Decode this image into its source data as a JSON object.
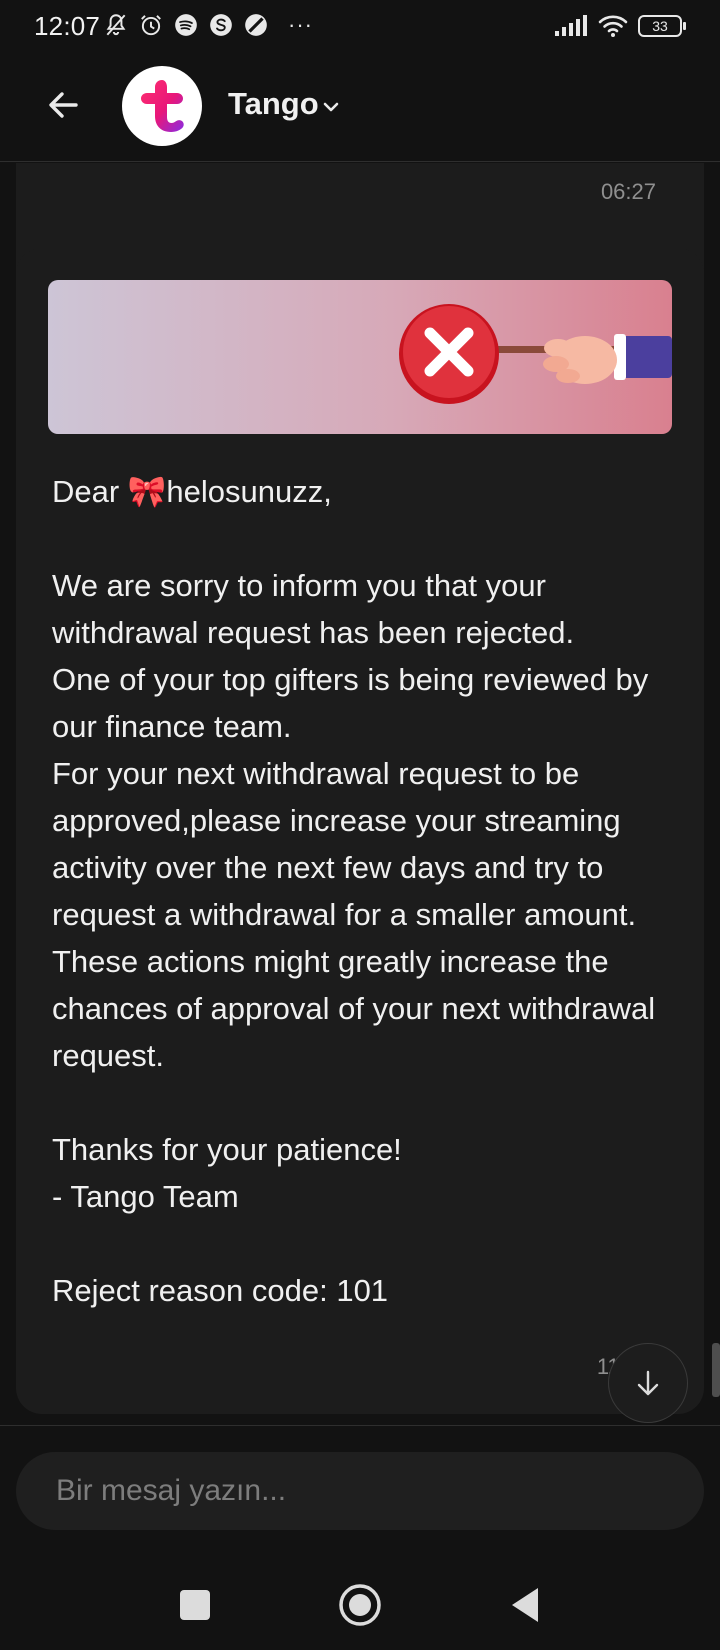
{
  "status_bar": {
    "time": "12:07",
    "battery": "33",
    "more": "···",
    "icons": [
      "bell-off-icon",
      "alarm-icon",
      "spotify-icon",
      "s-app-icon",
      "dnd-icon",
      "signal-icon",
      "wifi-icon",
      "battery-icon"
    ]
  },
  "header": {
    "title": "Tango",
    "avatar_letter": "t"
  },
  "chat": {
    "previous_message_time": "06:27",
    "message": {
      "text": "Dear 🎀helosunuzz,\n\nWe are sorry to inform you that your withdrawal request has been rejected.\nOne of your top gifters is being reviewed by our finance team.\nFor your next withdrawal request to be approved,please increase your streaming activity over the next few days and try to request a withdrawal for a smaller amount.\nThese actions might greatly increase the chances of approval of your next withdrawal request.\n\nThanks for your patience!\n- Tango Team\n\nReject reason code: 101",
      "time": "11:0"
    }
  },
  "input": {
    "placeholder": "Bir mesaj yazın..."
  },
  "colors": {
    "background": "#121212",
    "bubble": "#1c1c1c",
    "brand_pink": "#e8177a",
    "brand_purple": "#8a2be2",
    "reject_red": "#d8232f"
  }
}
